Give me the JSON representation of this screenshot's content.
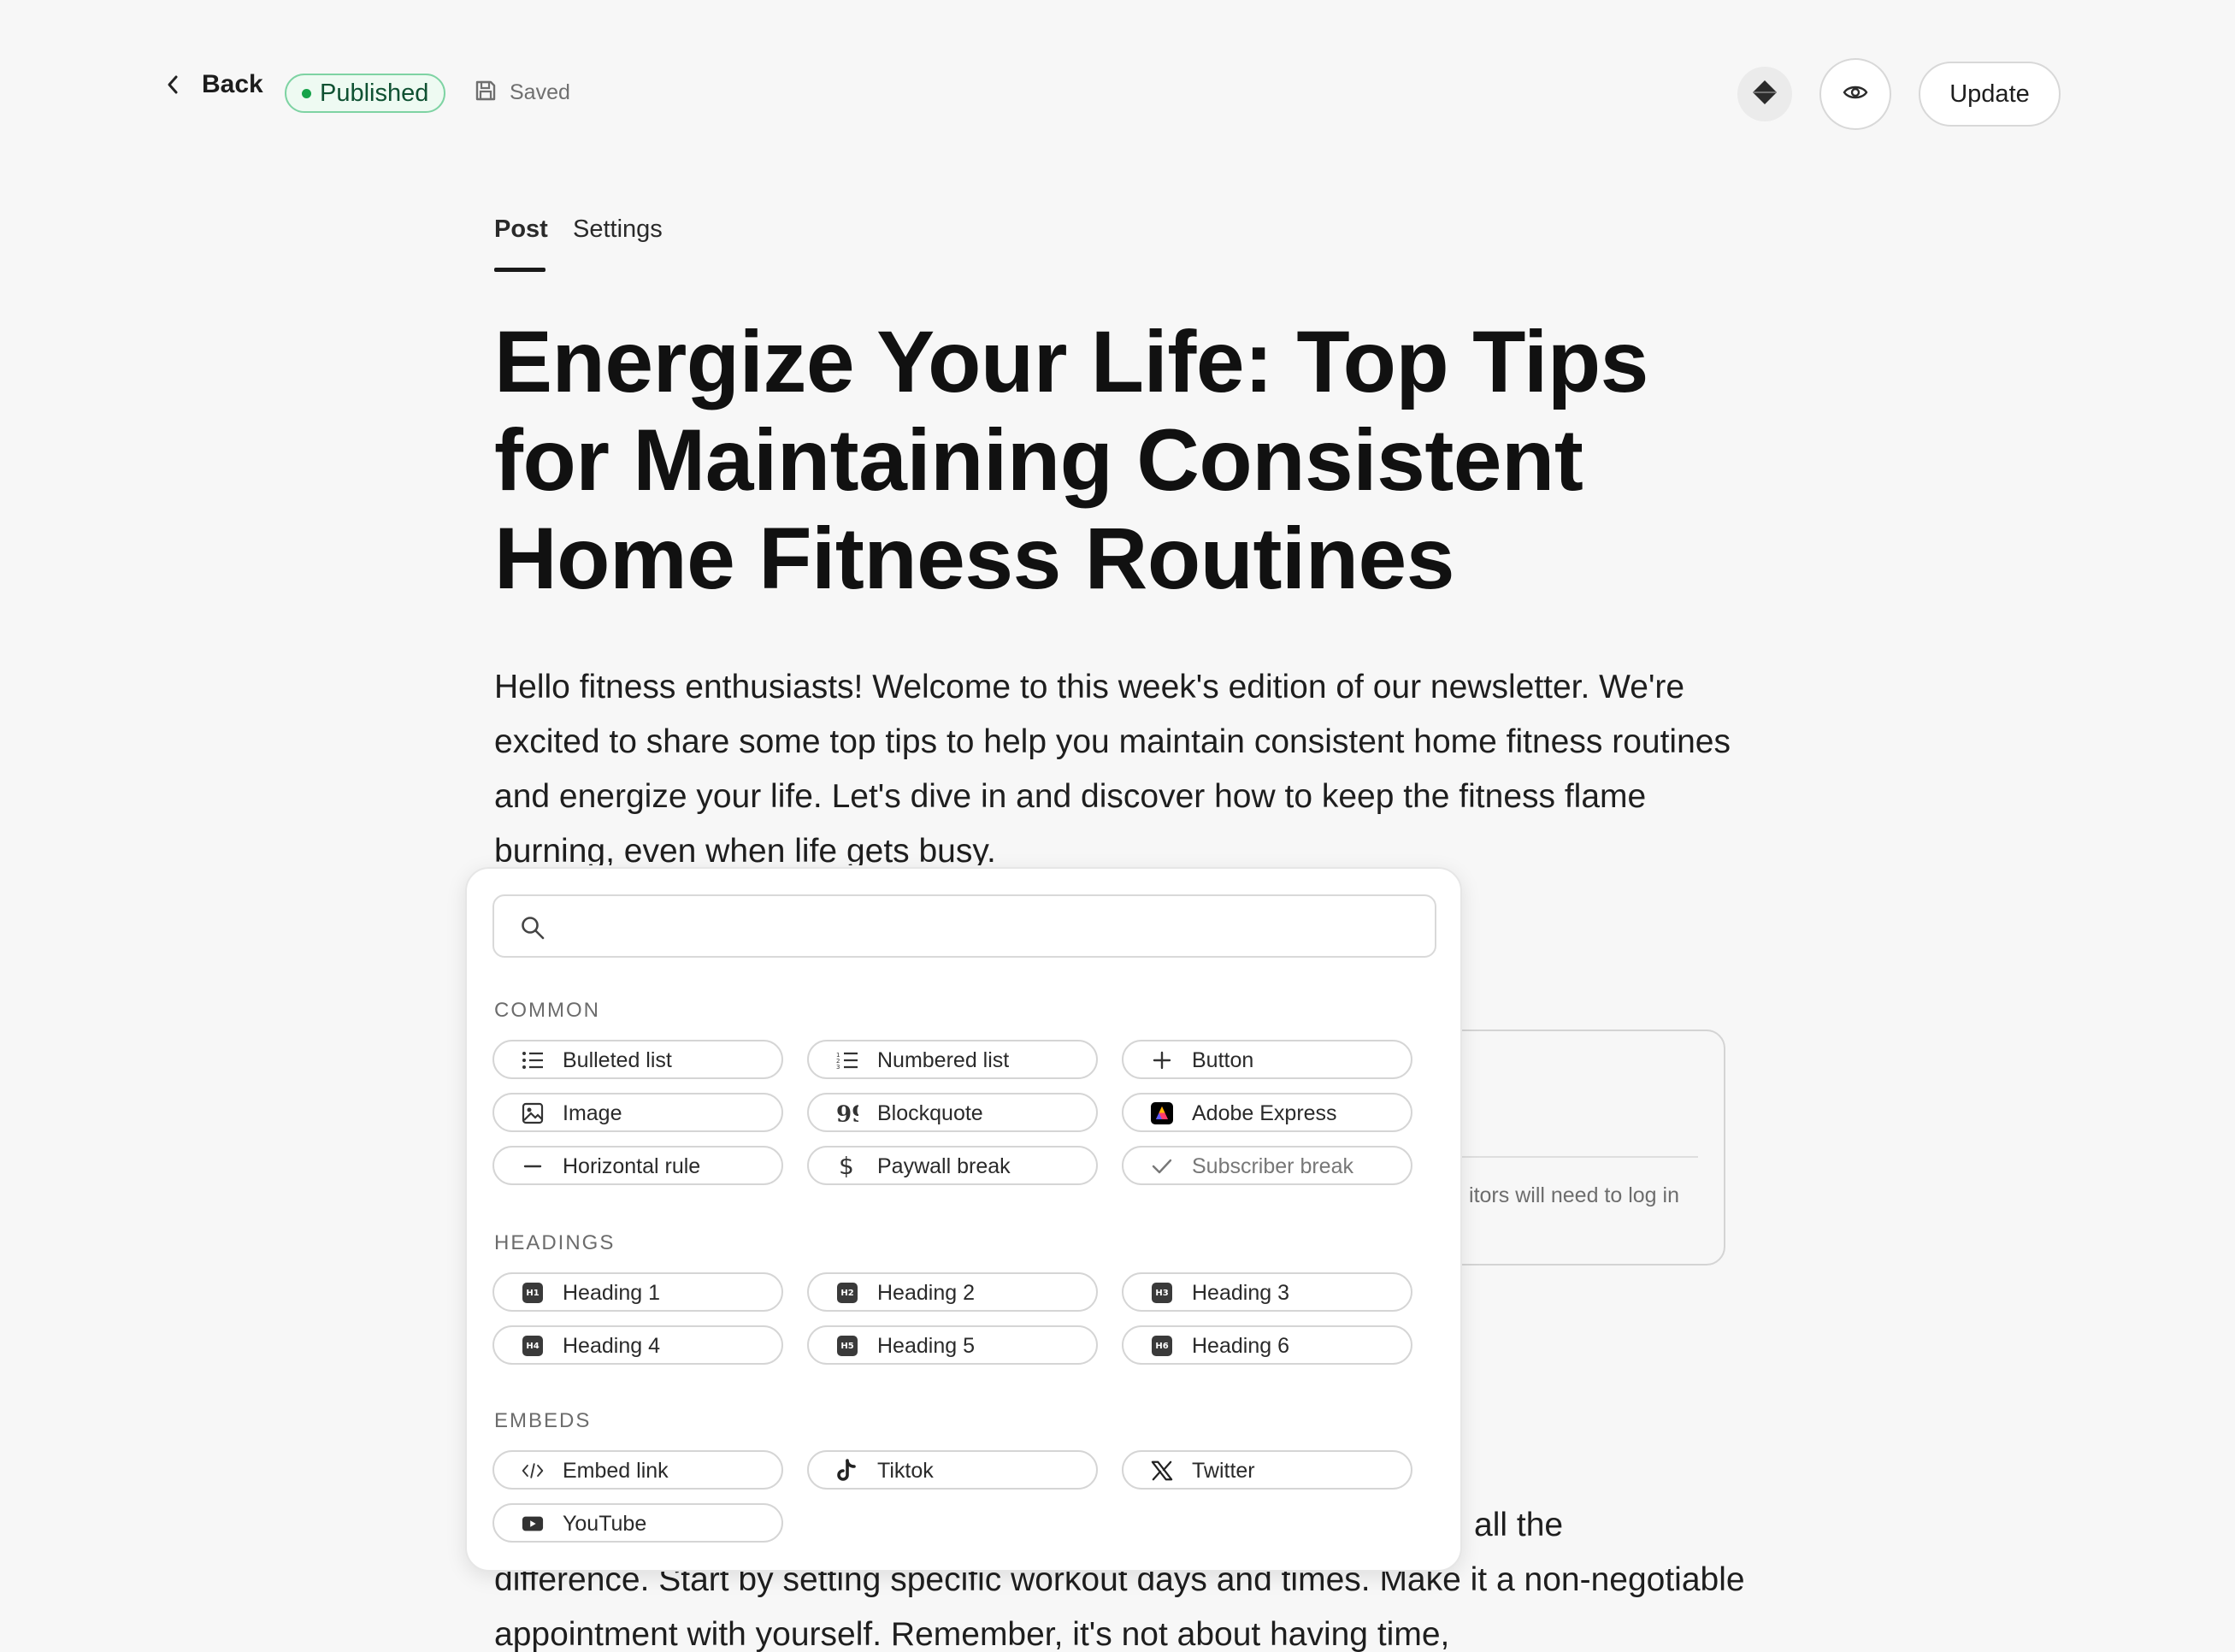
{
  "topbar": {
    "back_label": "Back",
    "status_badge": "Published",
    "saved_label": "Saved",
    "update_label": "Update"
  },
  "tabs": [
    {
      "label": "Post",
      "active": true
    },
    {
      "label": "Settings",
      "active": false
    }
  ],
  "article": {
    "title": "Energize Your Life: Top Tips for Maintaining Consistent Home Fitness Routines",
    "intro": "Hello fitness enthusiasts! Welcome to this week's edition of our newsletter. We're excited to share some top tips to help you maintain consistent home fitness routines and energize your life. Let's dive in and discover how to keep the fitness flame burning, even when life gets busy.",
    "partial_right": "all the",
    "tail": "difference. Start by setting specific workout days and times. Make it a non-negotiable appointment with yourself. Remember, it's not about having time,",
    "card_note": "itors will need to log in"
  },
  "insert_menu": {
    "search_placeholder": "",
    "sections": [
      {
        "label": "COMMON",
        "items": [
          {
            "label": "Bulleted list",
            "icon": "bulleted-list-icon"
          },
          {
            "label": "Numbered list",
            "icon": "numbered-list-icon"
          },
          {
            "label": "Button",
            "icon": "plus-icon"
          },
          {
            "label": "Image",
            "icon": "image-icon"
          },
          {
            "label": "Blockquote",
            "icon": "quote-icon"
          },
          {
            "label": "Adobe Express",
            "icon": "adobe-express-icon"
          },
          {
            "label": "Horizontal rule",
            "icon": "horizontal-rule-icon"
          },
          {
            "label": "Paywall break",
            "icon": "dollar-icon"
          },
          {
            "label": "Subscriber break",
            "icon": "check-icon"
          }
        ]
      },
      {
        "label": "HEADINGS",
        "items": [
          {
            "label": "Heading 1",
            "icon": "h1-icon",
            "badge": "H1"
          },
          {
            "label": "Heading 2",
            "icon": "h2-icon",
            "badge": "H2"
          },
          {
            "label": "Heading 3",
            "icon": "h3-icon",
            "badge": "H3"
          },
          {
            "label": "Heading 4",
            "icon": "h4-icon",
            "badge": "H4"
          },
          {
            "label": "Heading 5",
            "icon": "h5-icon",
            "badge": "H5"
          },
          {
            "label": "Heading 6",
            "icon": "h6-icon",
            "badge": "H6"
          }
        ]
      },
      {
        "label": "EMBEDS",
        "items": [
          {
            "label": "Embed link",
            "icon": "code-icon"
          },
          {
            "label": "Tiktok",
            "icon": "tiktok-icon"
          },
          {
            "label": "Twitter",
            "icon": "x-twitter-icon"
          },
          {
            "label": "YouTube",
            "icon": "youtube-icon"
          }
        ]
      }
    ]
  },
  "colors": {
    "published_green": "#16a34a",
    "background": "#f7f7f7",
    "text": "#1a1a1a"
  }
}
